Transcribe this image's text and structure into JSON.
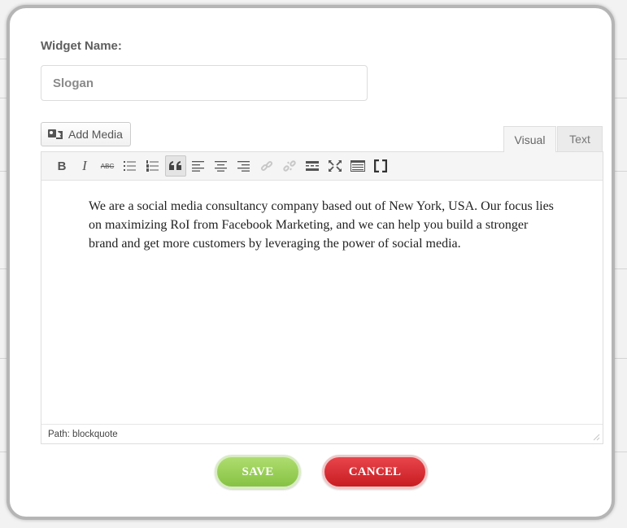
{
  "widget": {
    "name_label": "Widget Name:",
    "name_value": "Slogan"
  },
  "editor": {
    "add_media_label": "Add Media",
    "tabs": {
      "visual": "Visual",
      "text": "Text"
    },
    "toolbar": {
      "bold": "B",
      "italic": "I",
      "strikethrough": "ABC"
    },
    "content": "We are a social media consultancy company based out of New York, USA. Our focus lies on maximizing RoI from Facebook Marketing, and we can help you build a stronger brand and get more customers by leveraging the power of social media.",
    "path_label": "Path: blockquote"
  },
  "actions": {
    "save_label": "SAVE",
    "cancel_label": "CANCEL"
  },
  "colors": {
    "save": "#86c243",
    "cancel": "#c81c22"
  }
}
